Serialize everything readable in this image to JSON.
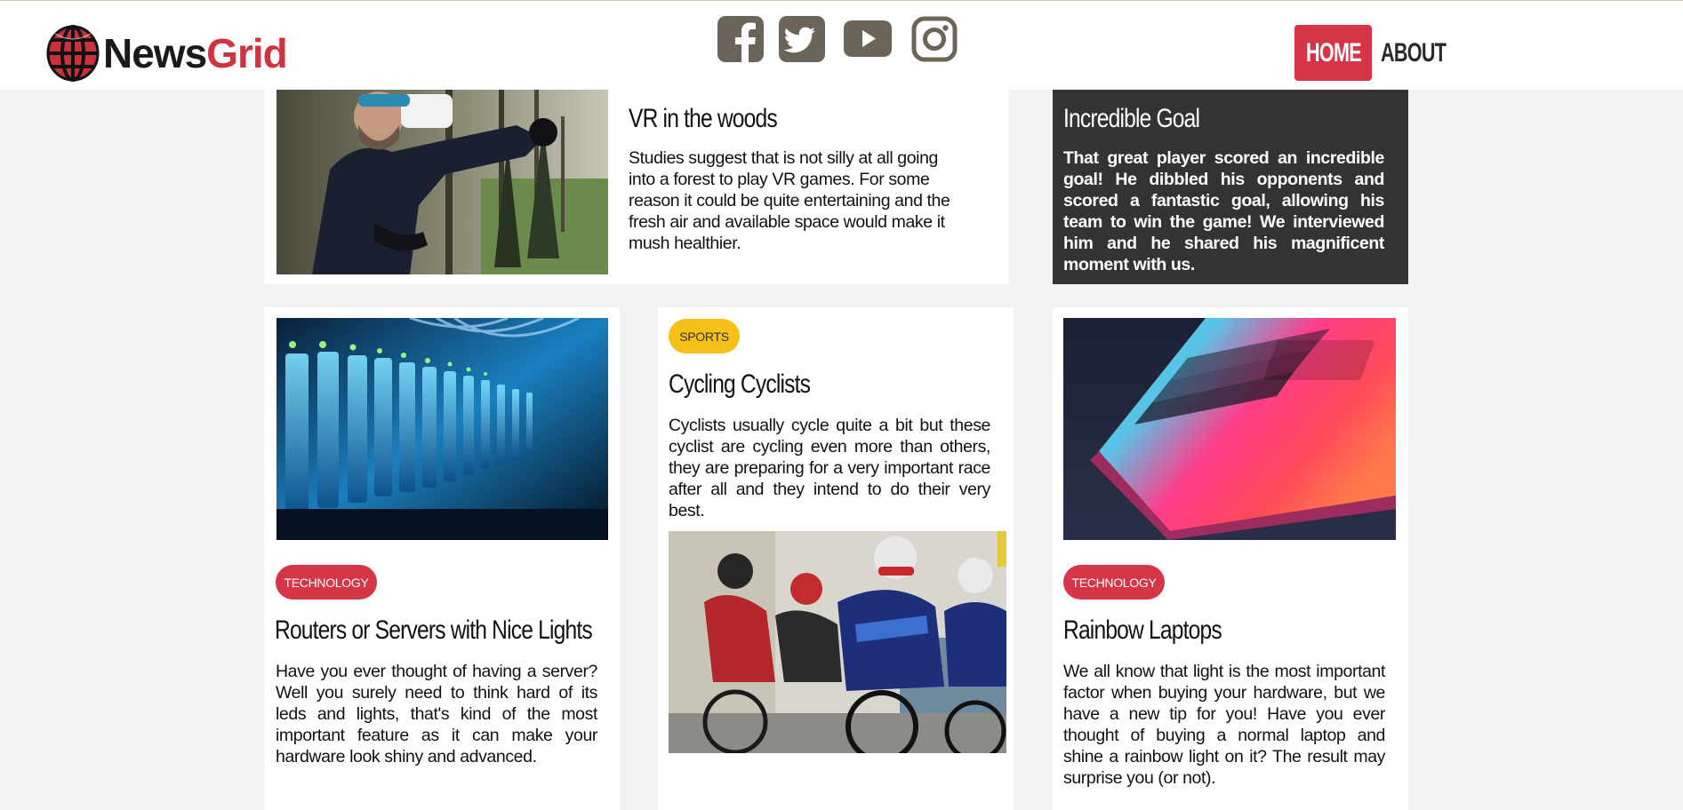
{
  "brand": {
    "name_part1": "News",
    "name_part2": "Grid"
  },
  "socials": [
    {
      "icon": "facebook-icon"
    },
    {
      "icon": "twitter-icon"
    },
    {
      "icon": "youtube-icon"
    },
    {
      "icon": "instagram-icon"
    }
  ],
  "nav": {
    "home": "HOME",
    "about": "ABOUT"
  },
  "colors": {
    "accent": "#d63447",
    "sports": "#f5c018",
    "dark_card": "#333333",
    "social": "#6b6458"
  },
  "articles": {
    "vr": {
      "title": "VR in the woods",
      "text": "Studies suggest that is not silly at all going into a forest to play VR games. For some reason it could be quite entertaining and the fresh air and available space would make it mush healthier."
    },
    "goal": {
      "title": "Incredible Goal",
      "text": "That great player scored an incredible goal! He dibbled his opponents and scored a fantastic goal, allowing his team to win the game! We interviewed him and he shared his magnificent moment with us."
    },
    "routers": {
      "badge": "TECHNOLOGY",
      "title": "Routers or Servers with Nice Lights",
      "text": "Have you ever thought of having a server? Well you surely need to think hard of its leds and lights, that's kind of the most important feature as it can make your hardware look shiny and advanced."
    },
    "cycling": {
      "badge": "SPORTS",
      "title": "Cycling Cyclists",
      "text": "Cyclists usually cycle quite a bit but these cyclist are cycling even more than others, they are preparing for a very important race after all and they intend to do their very best."
    },
    "laptops": {
      "badge": "TECHNOLOGY",
      "title": "Rainbow Laptops",
      "text": "We all know that light is the most important factor when buying your hardware, but we have a new tip for you! Have you ever thought of buying a normal laptop and shine a rainbow light on it? The result may surprise you (or not)."
    }
  }
}
